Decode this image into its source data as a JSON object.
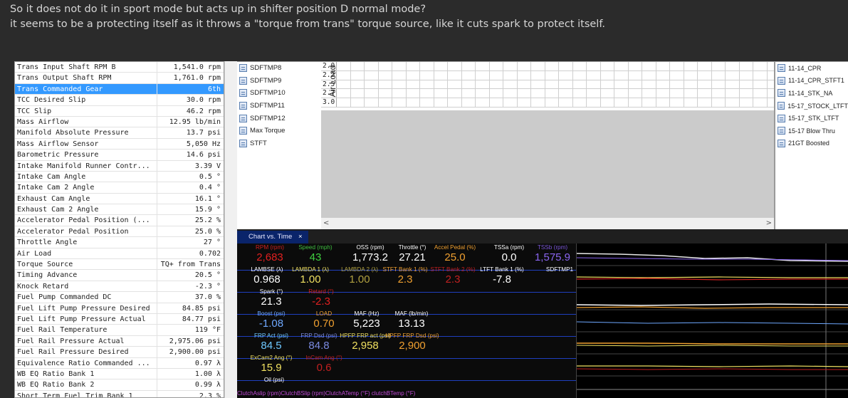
{
  "post": {
    "line1": "So it does not do it in sport mode but acts up in shifter position D normal mode?",
    "line2": "it seems to be a protecting itself as it throws a \"torque from trans\" torque source, like it cuts spark to protect itself."
  },
  "params": [
    {
      "name": "Trans Input Shaft RPM B",
      "value": "1,541.0 rpm"
    },
    {
      "name": "Trans Output Shaft RPM",
      "value": "1,761.0 rpm"
    },
    {
      "name": "Trans Commanded Gear",
      "value": "6th",
      "selected": true
    },
    {
      "name": "TCC Desired Slip",
      "value": "30.0 rpm"
    },
    {
      "name": "TCC Slip",
      "value": "46.2 rpm"
    },
    {
      "name": "Mass Airflow",
      "value": "12.95 lb/min"
    },
    {
      "name": "Manifold Absolute Pressure",
      "value": "13.7 psi"
    },
    {
      "name": "Mass Airflow Sensor",
      "value": "5,050 Hz"
    },
    {
      "name": "Barometric Pressure",
      "value": "14.6 psi"
    },
    {
      "name": "Intake Manifold Runner Contr...",
      "value": "3.39 V"
    },
    {
      "name": "Intake Cam Angle",
      "value": "0.5 °"
    },
    {
      "name": "Intake Cam 2 Angle",
      "value": "0.4 °"
    },
    {
      "name": "Exhaust Cam Angle",
      "value": "16.1 °"
    },
    {
      "name": "Exhaust Cam 2 Angle",
      "value": "15.9 °"
    },
    {
      "name": "Accelerator Pedal Position (...",
      "value": "25.2 %"
    },
    {
      "name": "Accelerator Pedal Position",
      "value": "25.0 %"
    },
    {
      "name": "Throttle Angle",
      "value": "27 °"
    },
    {
      "name": "Air Load",
      "value": "0.702"
    },
    {
      "name": "Torque Source",
      "value": "TQ+ from Trans"
    },
    {
      "name": "Timing Advance",
      "value": "20.5 °"
    },
    {
      "name": "Knock Retard",
      "value": "-2.3 °"
    },
    {
      "name": "Fuel Pump Commanded DC",
      "value": "37.0 %"
    },
    {
      "name": "Fuel Lift Pump Pressure Desired",
      "value": "84.85 psi"
    },
    {
      "name": "Fuel Lift Pump Pressure Actual",
      "value": "84.77 psi"
    },
    {
      "name": "Fuel Rail Temperature",
      "value": "119 °F"
    },
    {
      "name": "Fuel Rail Pressure Actual",
      "value": "2,975.06 psi"
    },
    {
      "name": "Fuel Rail Pressure Desired",
      "value": "2,900.00 psi"
    },
    {
      "name": "Equivalence Ratio Commanded ...",
      "value": "0.97 λ"
    },
    {
      "name": "WB EQ Ratio Bank 1",
      "value": "1.00 λ"
    },
    {
      "name": "WB EQ Ratio Bank 2",
      "value": "0.99 λ"
    },
    {
      "name": "Short Term Fuel Trim Bank 1",
      "value": "2.3 %"
    }
  ],
  "tables_mid": [
    "SDFTMP8",
    "SDFTMP9",
    "SDFTMP10",
    "SDFTMP11",
    "SDFTMP12",
    "Max Torque",
    "STFT"
  ],
  "tables_right": [
    "11-14_CPR",
    "11-14_CPR_STFT1",
    "11-14_STK_NA",
    "15-17_STOCK_LTFT",
    "15-17_STK_LTFT",
    "15-17 Blow Thru",
    "21GT Boosted"
  ],
  "grid": {
    "axis_label": "Air Load",
    "row_headers": [
      "2.0",
      "2.2",
      "2.5",
      "2.7",
      "3.0"
    ]
  },
  "dash": {
    "tab_label": "Chart vs. Time",
    "tab_close": "×",
    "footer": "ClutchAslip (rpm)ClutchBSlip (rpm)ClutchATemp (°F) clutchBTemp (°F)",
    "gauges": [
      {
        "id": "rpm",
        "label": "RPM (rpm)",
        "value": "2,683",
        "lc": "#d02020",
        "vc": "#e02020"
      },
      {
        "id": "speed",
        "label": "Speed (mph)",
        "value": "43",
        "lc": "#3fbf3f",
        "vc": "#3fcf3f"
      },
      {
        "id": "oss",
        "label": "OSS (rpm)",
        "value": "1,773.2",
        "lc": "#ffffff",
        "vc": "#ffffff"
      },
      {
        "id": "throttle",
        "label": "Throttle (°)",
        "value": "27.21",
        "lc": "#ffffff",
        "vc": "#ffffff"
      },
      {
        "id": "pedal",
        "label": "Accel Pedal (%)",
        "value": "25.0",
        "lc": "#f0a030",
        "vc": "#f0a030"
      },
      {
        "id": "tssa",
        "label": "TSSa (rpm)",
        "value": "0.0",
        "lc": "#ffffff",
        "vc": "#ffffff"
      },
      {
        "id": "tssb",
        "label": "TSSb (rpm)",
        "value": "1,575.9",
        "lc": "#7a55d8",
        "vc": "#8a65f0"
      },
      {
        "id": "lambse",
        "label": "LAMBSE (λ)",
        "value": "0.968",
        "lc": "#ffffff",
        "vc": "#ffffff"
      },
      {
        "id": "lambda1",
        "label": "LAMBDA 1 (λ)",
        "value": "1.00",
        "lc": "#f0e060",
        "vc": "#f0e060"
      },
      {
        "id": "lambda2",
        "label": "LAMBDA 2 (λ)",
        "value": "1.00",
        "lc": "#b0a040",
        "vc": "#b0a040"
      },
      {
        "id": "stft1",
        "label": "STFT Bank 1 (%)",
        "value": "2.3",
        "lc": "#f0a030",
        "vc": "#f0a030"
      },
      {
        "id": "stft2",
        "label": "STFT Bank 2 (%)",
        "value": "2.3",
        "lc": "#c02020",
        "vc": "#c02020"
      },
      {
        "id": "ltft1",
        "label": "LTFT Bank 1 (%)",
        "value": "-7.8",
        "lc": "#ffffff",
        "vc": "#ffffff"
      },
      {
        "id": "sdftmp1",
        "label": "SDFTMP1",
        "value": "",
        "lc": "#ffffff",
        "vc": "#ffffff"
      },
      {
        "id": "spark",
        "label": "Spark (°)",
        "value": "21.3",
        "lc": "#ffffff",
        "vc": "#ffffff"
      },
      {
        "id": "retard",
        "label": "Retard (°)",
        "value": "-2.3",
        "lc": "#d02020",
        "vc": "#e02020"
      },
      {
        "id": "boost",
        "label": "Boost (psi)",
        "value": "-1.08",
        "lc": "#6ea8ff",
        "vc": "#6ea8ff"
      },
      {
        "id": "load",
        "label": "LOAD",
        "value": "0.70",
        "lc": "#f0a030",
        "vc": "#f0a030"
      },
      {
        "id": "maf",
        "label": "MAF (Hz)",
        "value": "5,223",
        "lc": "#ffffff",
        "vc": "#ffffff"
      },
      {
        "id": "maflb",
        "label": "MAF (lb/min)",
        "value": "13.13",
        "lc": "#ffffff",
        "vc": "#ffffff"
      },
      {
        "id": "frpact",
        "label": "FRP Act (psi)",
        "value": "84.5",
        "lc": "#6ec8ff",
        "vc": "#6ec8ff"
      },
      {
        "id": "frpdsd",
        "label": "FRP Dsd (psi)",
        "value": "84.8",
        "lc": "#7a8ae0",
        "vc": "#7a8ae0"
      },
      {
        "id": "hpfpact",
        "label": "HPFP FRP act (psi)",
        "value": "2,958",
        "lc": "#f0e060",
        "vc": "#f0e060"
      },
      {
        "id": "hpfpdsd",
        "label": "HPFP FRP Dsd (psi)",
        "value": "2,900",
        "lc": "#f0a030",
        "vc": "#f0a030"
      },
      {
        "id": "excam",
        "label": "ExCam2 Ang (°)",
        "value": "15.9",
        "lc": "#f0e060",
        "vc": "#f0e060"
      },
      {
        "id": "incam",
        "label": "InCam Ang (°)",
        "value": "0.6",
        "lc": "#c02020",
        "vc": "#c02020"
      },
      {
        "id": "oil",
        "label": "Oil (psi)",
        "value": "",
        "lc": "#ffffff",
        "vc": "#ffffff"
      }
    ]
  },
  "colors": {
    "selection": "#3399ff",
    "tab": "#0a246a",
    "footer": "#c24bd8"
  }
}
